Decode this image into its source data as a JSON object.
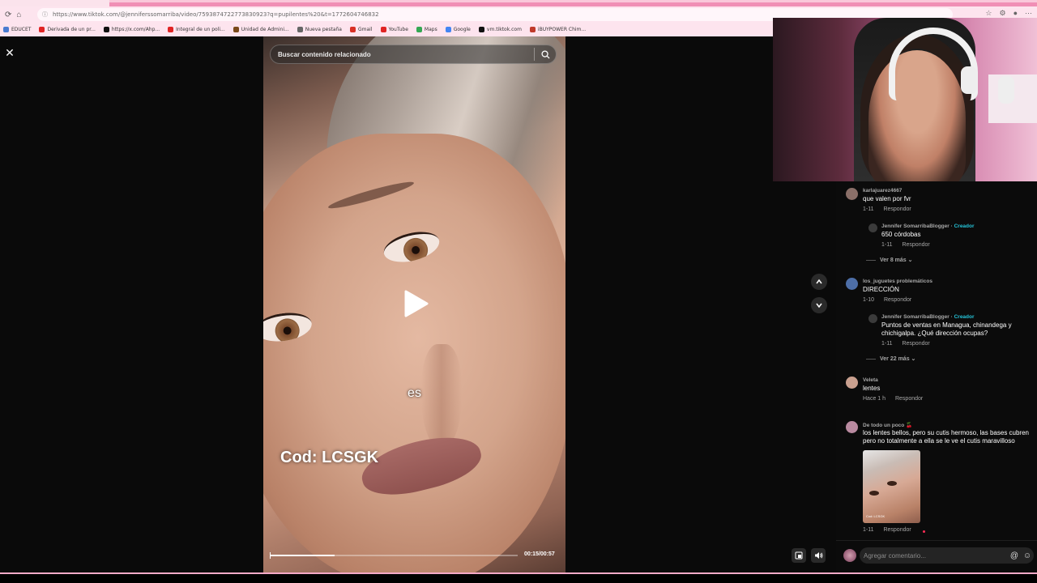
{
  "browser": {
    "url": "https://www.tiktok.com/@jenniferssomarriba/video/7593874722773830923?q=pupilentes%20&t=1772604746832",
    "bookmarks": [
      {
        "label": "EDUCET",
        "color": "#4a7bd0"
      },
      {
        "label": "Derivada de un pr...",
        "color": "#e02424"
      },
      {
        "label": "https://x.com/Ahp...",
        "color": "#111111"
      },
      {
        "label": "Integral de un poli...",
        "color": "#e02424"
      },
      {
        "label": "Unidad de Admini...",
        "color": "#7a4a1a"
      },
      {
        "label": "Nueva pestaña",
        "color": "#666666"
      },
      {
        "label": "Gmail",
        "color": "#d93025"
      },
      {
        "label": "YouTube",
        "color": "#e02424"
      },
      {
        "label": "Maps",
        "color": "#34a853"
      },
      {
        "label": "Google",
        "color": "#4285f4"
      },
      {
        "label": "vm.tiktok.com",
        "color": "#111111"
      },
      {
        "label": "iBUYPOWER Chim...",
        "color": "#c0392b"
      }
    ]
  },
  "video": {
    "search_placeholder": "Buscar contenido relacionado",
    "caption_small": "es",
    "caption_code": "Cod: LCSGK",
    "time": "00:15/00:57",
    "progress_fraction": 0.26
  },
  "comments": [
    {
      "user": "karlajuarez4667",
      "text": "que valen por fvr",
      "date": "1-11",
      "reply_label": "Respondor",
      "replies": [
        {
          "user": "Jennifer SomarribaBlogger",
          "badge": "Creador",
          "text": "650 córdobas",
          "date": "1-11",
          "reply_label": "Respondor"
        }
      ],
      "more": "Ver 8 más"
    },
    {
      "user": "los_juguetes problemáticos",
      "text": "DIRECCIÓN",
      "date": "1-10",
      "reply_label": "Respondor",
      "replies": [
        {
          "user": "Jennifer SomarribaBlogger",
          "badge": "Creador",
          "text": "Puntos de ventas en Managua, chinandega y chichigalpa. ¿Qué dirección ocupas?",
          "date": "1-11",
          "reply_label": "Respondor"
        }
      ],
      "more": "Ver 22 más"
    },
    {
      "user": "Veleta",
      "text": "lentes",
      "date": "Hace 1 h",
      "reply_label": "Respondor"
    },
    {
      "user": "De todo un poco 🍒",
      "text": "los lentes bellos, pero su cutis hermoso, las bases cubren pero no totalmente a ella se le ve el cutis maravilloso",
      "date": "1-11",
      "reply_label": "Respondor"
    }
  ],
  "thumb_code": "Cod: LCSGK",
  "comment_input": {
    "placeholder": "Agregar comentario..."
  },
  "accent_color": "#fe2c55",
  "creator_color": "#25c3d8"
}
